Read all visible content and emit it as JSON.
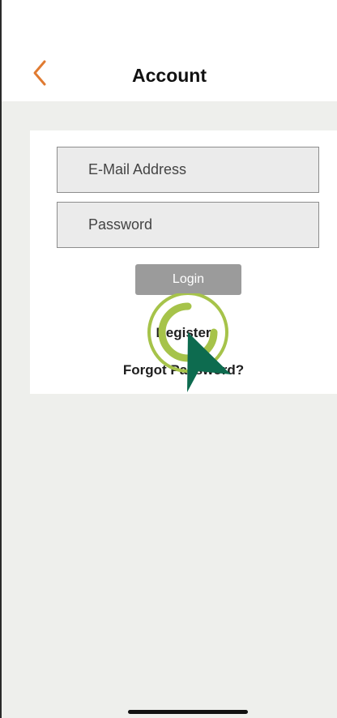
{
  "header": {
    "title": "Account",
    "back_icon": "chevron-left-icon",
    "accent_color": "#e07b32"
  },
  "form": {
    "email_placeholder": "E-Mail Address",
    "password_placeholder": "Password",
    "login_label": "Login",
    "register_label": "Register",
    "forgot_label": "Forgot Password?"
  },
  "overlay": {
    "click_indicator_icon": "click-ripple-icon",
    "cursor_icon": "pointer-cursor-icon",
    "ring_color": "#a6c34a",
    "cursor_color": "#0d6b4f"
  }
}
